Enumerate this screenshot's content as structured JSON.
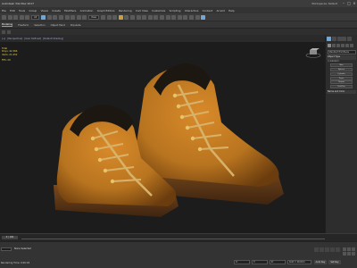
{
  "window": {
    "title": "Autodesk 3ds Max 2017",
    "workspace": "Workspaces: Default"
  },
  "menu": [
    "File",
    "Edit",
    "Tools",
    "Group",
    "Views",
    "Create",
    "Modifiers",
    "Animation",
    "Graph Editors",
    "Rendering",
    "Civil View",
    "Customize",
    "Scripting",
    "Interactive",
    "Content",
    "Arnold",
    "Help"
  ],
  "toolbar": {
    "selection_filter": "All",
    "view_mode": "View"
  },
  "ribbon": {
    "tabs": [
      "Modeling",
      "Freeform",
      "Selection",
      "Object Paint",
      "Populate"
    ],
    "active": "Modeling"
  },
  "viewport": {
    "tabs": [
      "[+]",
      "[Perspective]",
      "[User Defined]",
      "[Default Shading]"
    ],
    "stats": [
      "Total",
      "Polys: 42,366",
      "Verts: 21,452",
      "",
      "FPS: 29"
    ]
  },
  "command_panel": {
    "dropdown": "Standard Primitives",
    "rollout_object_type": "Object Type",
    "autogrid": "AutoGrid",
    "objects": [
      "Box",
      "Sphere",
      "Cylinder",
      "Torus",
      "Teapot",
      "TextPlus"
    ],
    "rollout_name_color": "Name and Color"
  },
  "timeline": {
    "slider": "0 / 100"
  },
  "status": {
    "selection": "None Selected",
    "render_time": "Rendering Time: 0:00:03",
    "x": "X:",
    "y": "Y:",
    "z": "Z:",
    "grid": "Grid = 10.0cm",
    "auto_key": "Auto Key",
    "set_key": "Set Key"
  },
  "colors": {
    "accent": "#6fa8d8",
    "boot_leather": "#b8741f",
    "laces": "#d7b268",
    "collar": "#1d1712",
    "stats_text": "#e6d24a"
  }
}
